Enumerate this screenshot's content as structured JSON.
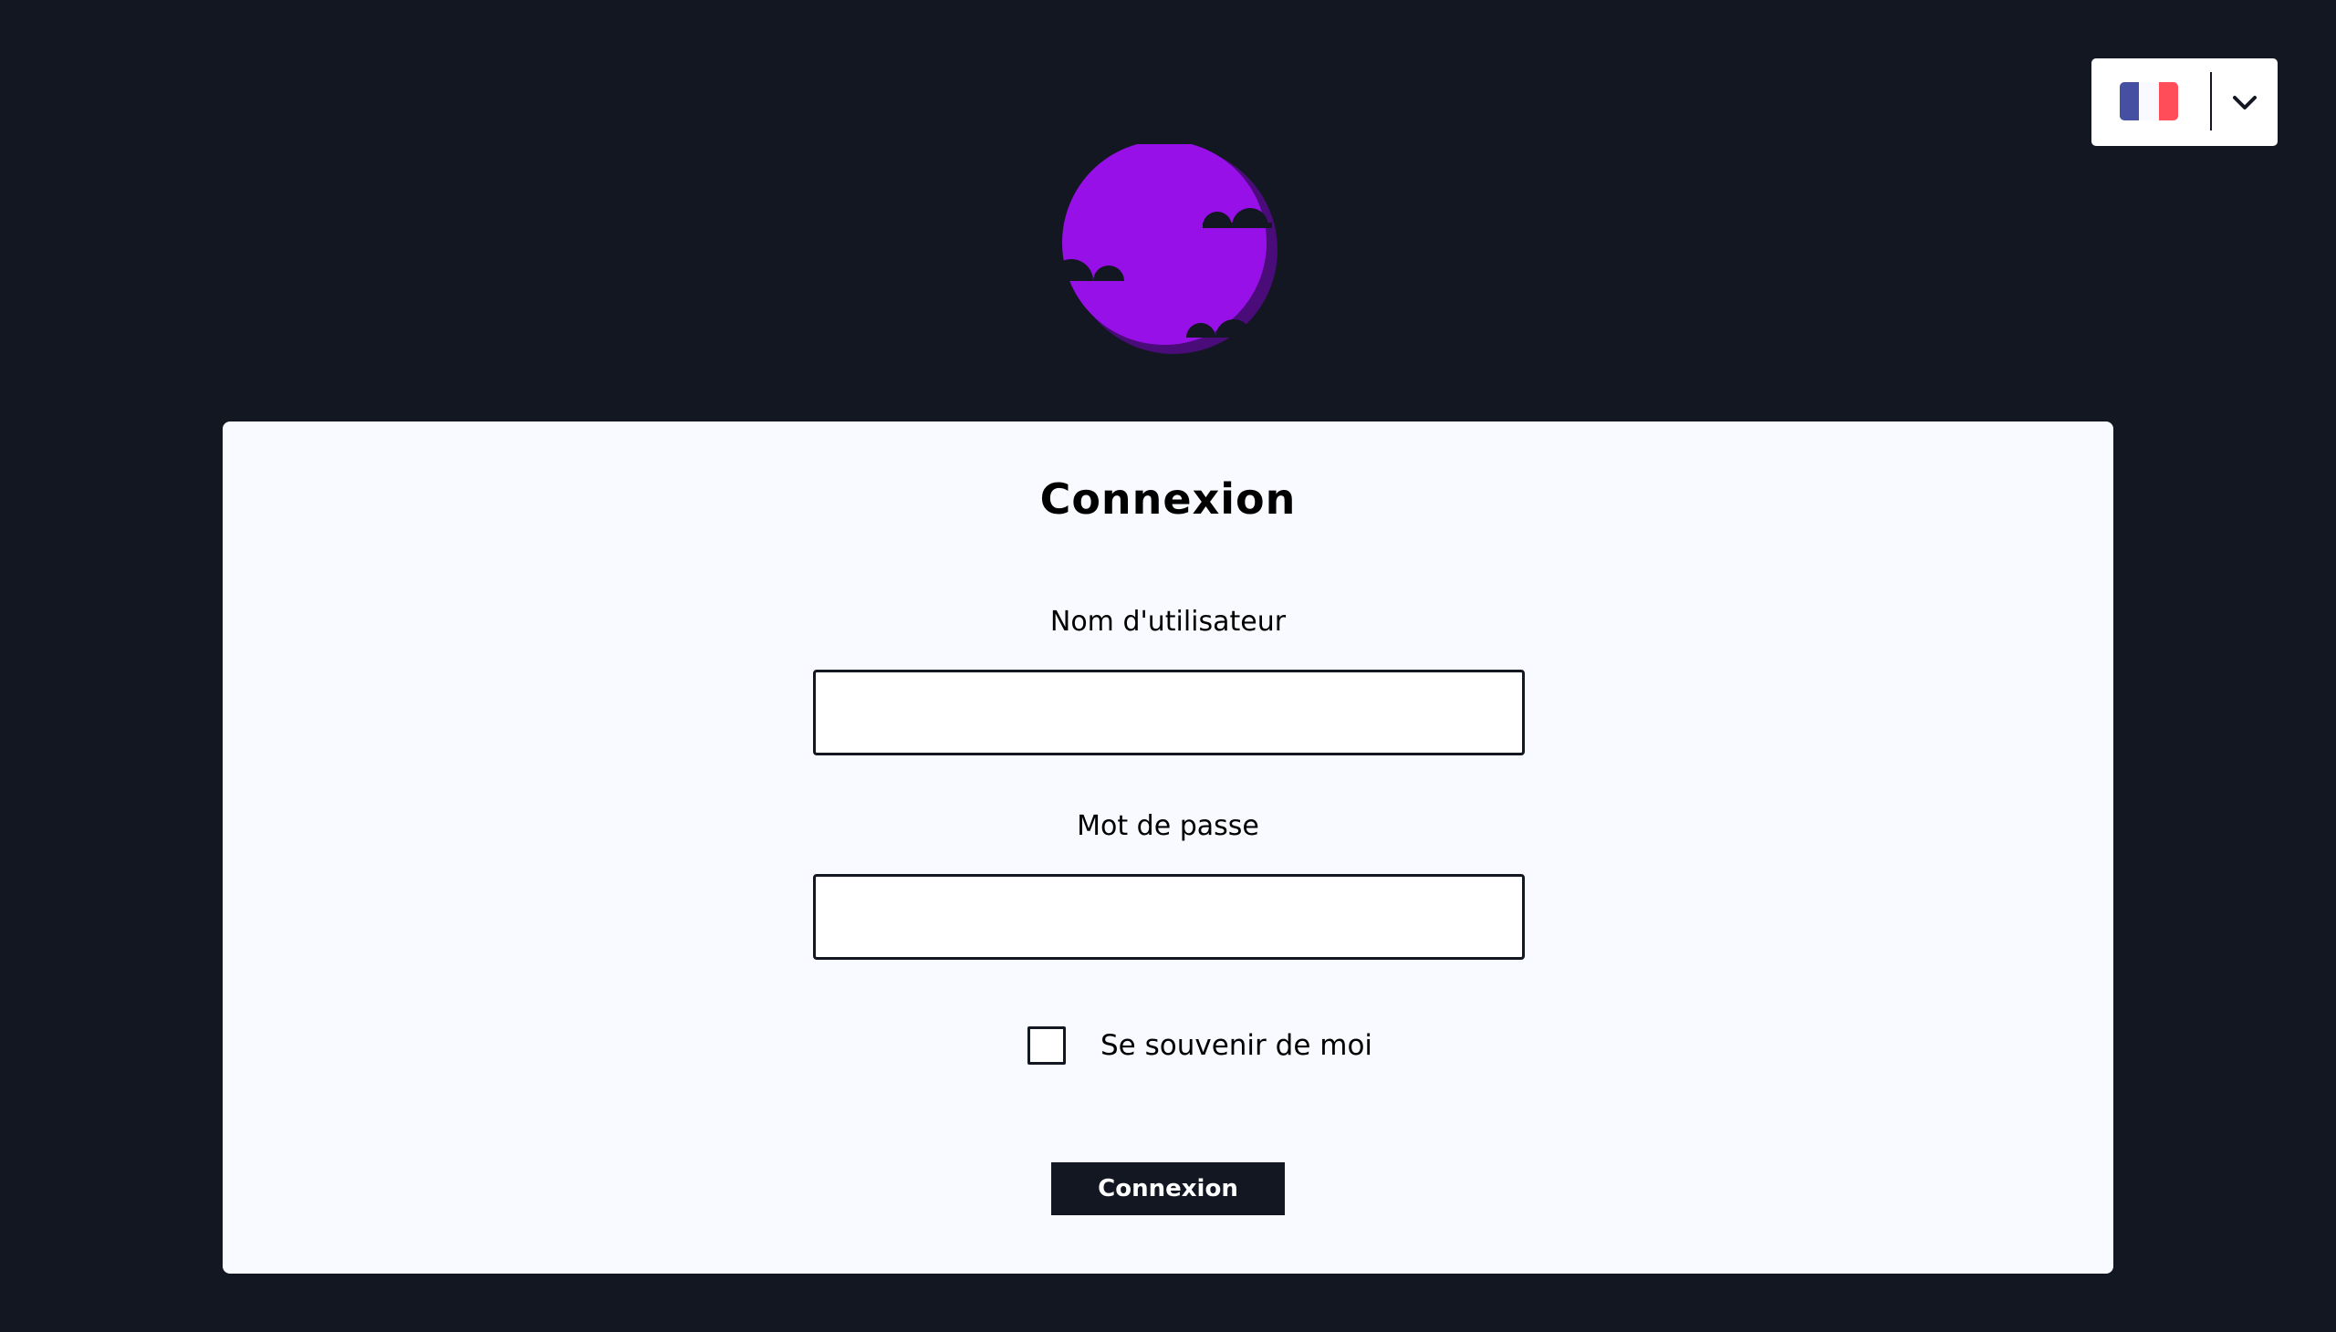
{
  "language": {
    "flag_colors": [
      "#4550a2",
      "#f8faff",
      "#ff4d5a"
    ],
    "flag_icon": "france-flag-icon",
    "dropdown_icon": "chevron-down-icon"
  },
  "logo": {
    "icon": "purple-moon-with-clouds-logo",
    "colors": {
      "moon": "#9810e8",
      "moon_shadow": "#4a0c78",
      "clouds": "#121722"
    }
  },
  "login": {
    "title": "Connexion",
    "username_label": "Nom d'utilisateur",
    "username_value": "",
    "password_label": "Mot de passe",
    "password_value": "",
    "remember_label": "Se souvenir de moi",
    "remember_checked": false,
    "submit_label": "Connexion"
  },
  "colors": {
    "background": "#121722",
    "card": "#f8faff",
    "accent": "#9810e8"
  }
}
